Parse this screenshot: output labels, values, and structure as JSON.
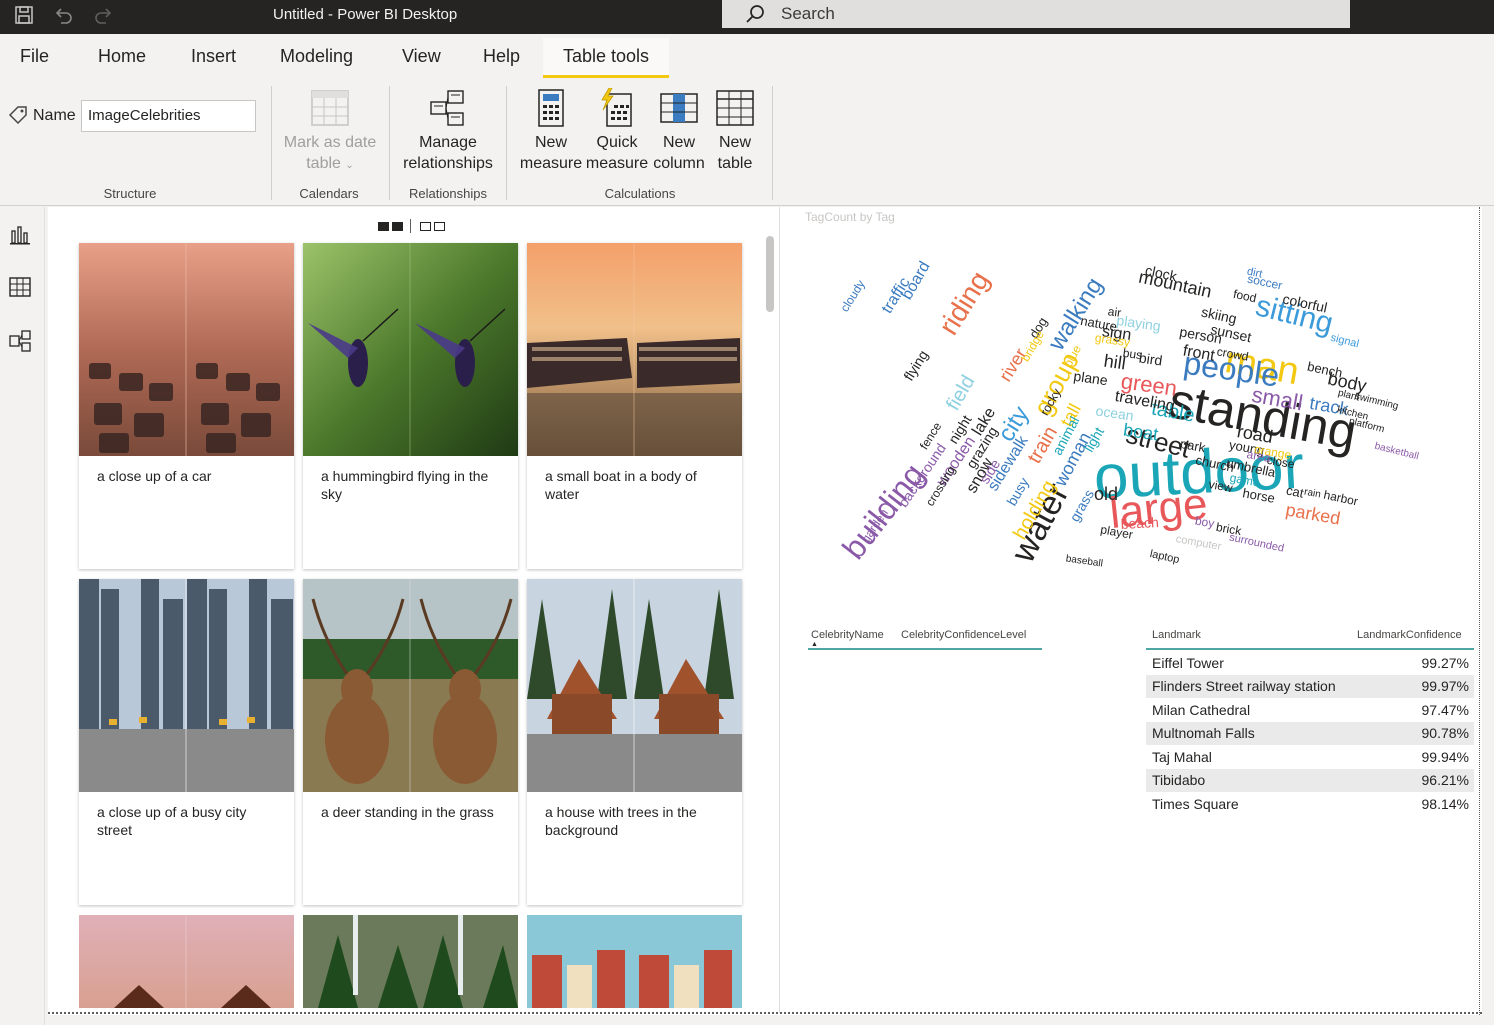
{
  "titlebar": {
    "title": "Untitled - Power BI Desktop",
    "search_placeholder": "Search"
  },
  "menu": {
    "tabs": [
      "File",
      "Home",
      "Insert",
      "Modeling",
      "View",
      "Help",
      "Table tools"
    ],
    "active_tab": "Table tools"
  },
  "ribbon": {
    "name_label": "Name",
    "name_value": "ImageCelebrities",
    "groups": {
      "structure": "Structure",
      "calendars": "Calendars",
      "relationships": "Relationships",
      "calculations": "Calculations"
    },
    "buttons": {
      "mark_date_1": "Mark as date",
      "mark_date_2": "table",
      "manage_rel_1": "Manage",
      "manage_rel_2": "relationships",
      "new_measure_1": "New",
      "new_measure_2": "measure",
      "quick_measure_1": "Quick",
      "quick_measure_2": "measure",
      "new_column_1": "New",
      "new_column_2": "column",
      "new_table_1": "New",
      "new_table_2": "table"
    }
  },
  "gallery": {
    "cards": [
      {
        "caption": "a close up of a car"
      },
      {
        "caption": "a hummingbird flying in the sky"
      },
      {
        "caption": "a small boat in a body of water"
      },
      {
        "caption": "a close up of a busy city street"
      },
      {
        "caption": "a deer standing in the grass"
      },
      {
        "caption": "a house with trees in the background"
      }
    ]
  },
  "wordcloud": {
    "title": "TagCount by Tag",
    "words": [
      {
        "text": "outdoor",
        "color": "#1aa6b7"
      },
      {
        "text": "standing",
        "color": "#252423"
      },
      {
        "text": "large",
        "color": "#e8575a"
      },
      {
        "text": "man",
        "color": "#f2c811"
      },
      {
        "text": "people",
        "color": "#3b7bbf"
      },
      {
        "text": "building",
        "color": "#8a5aa8"
      },
      {
        "text": "water",
        "color": "#252423"
      },
      {
        "text": "sitting",
        "color": "#3b9ad9"
      },
      {
        "text": "riding",
        "color": "#e8704a"
      },
      {
        "text": "street",
        "color": "#252423"
      },
      {
        "text": "small",
        "color": "#8a5aa8"
      },
      {
        "text": "green",
        "color": "#e8575a"
      },
      {
        "text": "group",
        "color": "#f2c811"
      },
      {
        "text": "walking",
        "color": "#3b7bbf"
      },
      {
        "text": "city",
        "color": "#3b9ad9"
      },
      {
        "text": "table",
        "color": "#1aa6b7"
      },
      {
        "text": "mountain",
        "color": "#252423"
      },
      {
        "text": "parked",
        "color": "#e8704a"
      },
      {
        "text": "track",
        "color": "#3b7bbf"
      },
      {
        "text": "body",
        "color": "#252423"
      },
      {
        "text": "road",
        "color": "#252423"
      },
      {
        "text": "holding",
        "color": "#f2c811"
      },
      {
        "text": "train",
        "color": "#e8704a"
      },
      {
        "text": "woman",
        "color": "#3b7bbf"
      },
      {
        "text": "field",
        "color": "#8ed1e0"
      },
      {
        "text": "boat",
        "color": "#1aa6b7"
      },
      {
        "text": "old",
        "color": "#252423"
      },
      {
        "text": "river",
        "color": "#e8704a"
      },
      {
        "text": "hill",
        "color": "#252423"
      },
      {
        "text": "traveling",
        "color": "#252423"
      },
      {
        "text": "front",
        "color": "#252423"
      },
      {
        "text": "tall",
        "color": "#f2c811"
      },
      {
        "text": "beach",
        "color": "#e8575a"
      },
      {
        "text": "traffic",
        "color": "#3b7bbf"
      },
      {
        "text": "board",
        "color": "#3b7bbf"
      },
      {
        "text": "sign",
        "color": "#252423"
      },
      {
        "text": "person",
        "color": "#252423"
      },
      {
        "text": "skiing",
        "color": "#252423"
      },
      {
        "text": "sunset",
        "color": "#252423"
      },
      {
        "text": "grass",
        "color": "#3b7bbf"
      },
      {
        "text": "snow",
        "color": "#252423"
      },
      {
        "text": "sidewalk",
        "color": "#3b7bbf"
      },
      {
        "text": "lake",
        "color": "#252423"
      },
      {
        "text": "busy",
        "color": "#3b7bbf"
      },
      {
        "text": "wooden",
        "color": "#8a5aa8"
      },
      {
        "text": "ocean",
        "color": "#8ed1e0"
      },
      {
        "text": "colorful",
        "color": "#252423"
      },
      {
        "text": "playing",
        "color": "#8ed1e0"
      },
      {
        "text": "clock",
        "color": "#252423"
      },
      {
        "text": "bird",
        "color": "#252423"
      },
      {
        "text": "bench",
        "color": "#252423"
      },
      {
        "text": "church",
        "color": "#252423"
      },
      {
        "text": "young",
        "color": "#252423"
      },
      {
        "text": "umbrella",
        "color": "#252423"
      },
      {
        "text": "flying",
        "color": "#252423"
      },
      {
        "text": "grazing",
        "color": "#252423"
      },
      {
        "text": "animal",
        "color": "#1aa6b7"
      },
      {
        "text": "night",
        "color": "#252423"
      },
      {
        "text": "plane",
        "color": "#252423"
      },
      {
        "text": "nature",
        "color": "#252423"
      },
      {
        "text": "dog",
        "color": "#252423"
      },
      {
        "text": "horse",
        "color": "#252423"
      },
      {
        "text": "cat",
        "color": "#252423"
      },
      {
        "text": "park",
        "color": "#252423"
      },
      {
        "text": "crowd",
        "color": "#252423"
      },
      {
        "text": "view",
        "color": "#252423"
      },
      {
        "text": "game",
        "color": "#1aa6b7"
      },
      {
        "text": "light",
        "color": "#1aa6b7"
      },
      {
        "text": "blue",
        "color": "#f2c811"
      },
      {
        "text": "rocky",
        "color": "#252423"
      },
      {
        "text": "side",
        "color": "#8a5aa8"
      },
      {
        "text": "fence",
        "color": "#252423"
      },
      {
        "text": "background",
        "color": "#8a5aa8"
      },
      {
        "text": "crossing",
        "color": "#252423"
      },
      {
        "text": "garden",
        "color": "#8a5aa8"
      },
      {
        "text": "air",
        "color": "#252423"
      },
      {
        "text": "grassy",
        "color": "#f2c811"
      },
      {
        "text": "orange",
        "color": "#f2c811"
      },
      {
        "text": "close",
        "color": "#252423"
      },
      {
        "text": "area",
        "color": "#8a5aa8"
      },
      {
        "text": "cloudy",
        "color": "#3b7bbf"
      },
      {
        "text": "boy",
        "color": "#8a5aa8"
      },
      {
        "text": "brick",
        "color": "#252423"
      },
      {
        "text": "computer",
        "color": "#c8c6c4"
      },
      {
        "text": "player",
        "color": "#252423"
      },
      {
        "text": "bus",
        "color": "#252423"
      },
      {
        "text": "harbor",
        "color": "#252423"
      },
      {
        "text": "soccer",
        "color": "#3b7bbf"
      },
      {
        "text": "signal",
        "color": "#3b9ad9"
      },
      {
        "text": "food",
        "color": "#252423"
      },
      {
        "text": "bridge",
        "color": "#f2c811"
      },
      {
        "text": "dirt",
        "color": "#3b7bbf"
      },
      {
        "text": "baseball",
        "color": "#252423"
      },
      {
        "text": "laptop",
        "color": "#252423"
      },
      {
        "text": "surrounded",
        "color": "#8a5aa8"
      },
      {
        "text": "kitchen",
        "color": "#252423"
      },
      {
        "text": "plant",
        "color": "#252423"
      },
      {
        "text": "rain",
        "color": "#252423"
      },
      {
        "text": "swimming",
        "color": "#252423"
      },
      {
        "text": "platform",
        "color": "#252423"
      },
      {
        "text": "basketball",
        "color": "#8a5aa8"
      }
    ]
  },
  "celeb_table": {
    "headers": [
      "CelebrityName",
      "CelebrityConfidenceLevel"
    ]
  },
  "landmark_table": {
    "headers": [
      "Landmark",
      "LandmarkConfidence"
    ],
    "rows": [
      {
        "landmark": "Eiffel Tower",
        "confidence": "99.27%"
      },
      {
        "landmark": "Flinders Street railway station",
        "confidence": "99.97%"
      },
      {
        "landmark": "Milan Cathedral",
        "confidence": "97.47%"
      },
      {
        "landmark": "Multnomah Falls",
        "confidence": "90.78%"
      },
      {
        "landmark": "Taj Mahal",
        "confidence": "99.94%"
      },
      {
        "landmark": "Tibidabo",
        "confidence": "96.21%"
      },
      {
        "landmark": "Times Square",
        "confidence": "98.14%"
      }
    ]
  }
}
